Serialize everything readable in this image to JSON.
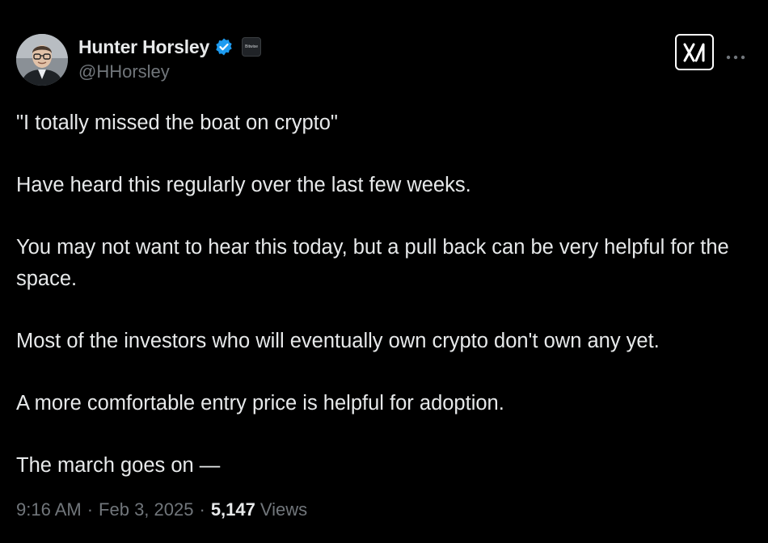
{
  "author": {
    "display_name": "Hunter Horsley",
    "handle": "@HHorsley",
    "avatar_icon": "person-photo-avatar",
    "verified_icon": "verified-badge-icon",
    "affiliate_badge": "Bitwise",
    "colors": {
      "verified": "#1d9bf0"
    }
  },
  "header_actions": {
    "logo_icon": "x-grok-logo-icon",
    "more_icon": "more-dots-icon"
  },
  "tweet": {
    "paragraphs": [
      "\"I totally missed the boat on crypto\"",
      "Have heard this regularly over the last few weeks.",
      "You may not want to hear this today, but a pull back can be very helpful for the space.",
      "Most of the investors who will eventually own crypto don't own any yet.",
      "A more comfortable entry price is helpful for adoption.",
      "The march goes on —"
    ]
  },
  "meta": {
    "time": "9:16 AM",
    "separator": "·",
    "date": "Feb 3, 2025",
    "views_count": "5,147",
    "views_label": "Views"
  },
  "colors": {
    "background": "#000000",
    "text_primary": "#e7e9ea",
    "text_secondary": "#71767b"
  }
}
